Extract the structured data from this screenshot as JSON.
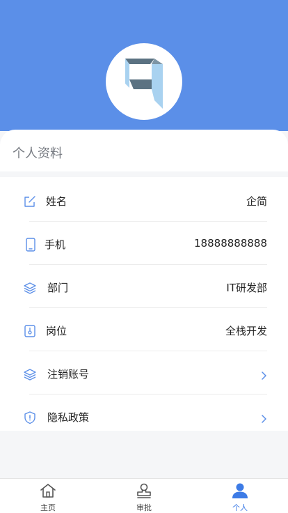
{
  "profile": {
    "section_title": "个人资料"
  },
  "rows": [
    {
      "label": "姓名",
      "value": "企简",
      "icon": "edit-icon"
    },
    {
      "label": "手机",
      "value": "18888888888",
      "icon": "phone-icon"
    },
    {
      "label": "部门",
      "value": "IT研发部",
      "icon": "layers-icon"
    },
    {
      "label": "岗位",
      "value": "全栈开发",
      "icon": "badge-icon"
    },
    {
      "label": "注销账号",
      "value": "",
      "icon": "layers-icon"
    },
    {
      "label": "隐私政策",
      "value": "",
      "icon": "shield-icon"
    }
  ],
  "tabbar": {
    "items": [
      {
        "label": "主页",
        "icon": "home-icon"
      },
      {
        "label": "审批",
        "icon": "stamp-icon"
      },
      {
        "label": "个人",
        "icon": "person-icon"
      }
    ],
    "active_color": "#3d7be6"
  },
  "colors": {
    "header_bg": "#5b8fe8",
    "icon_blue": "#5b8fe8"
  }
}
